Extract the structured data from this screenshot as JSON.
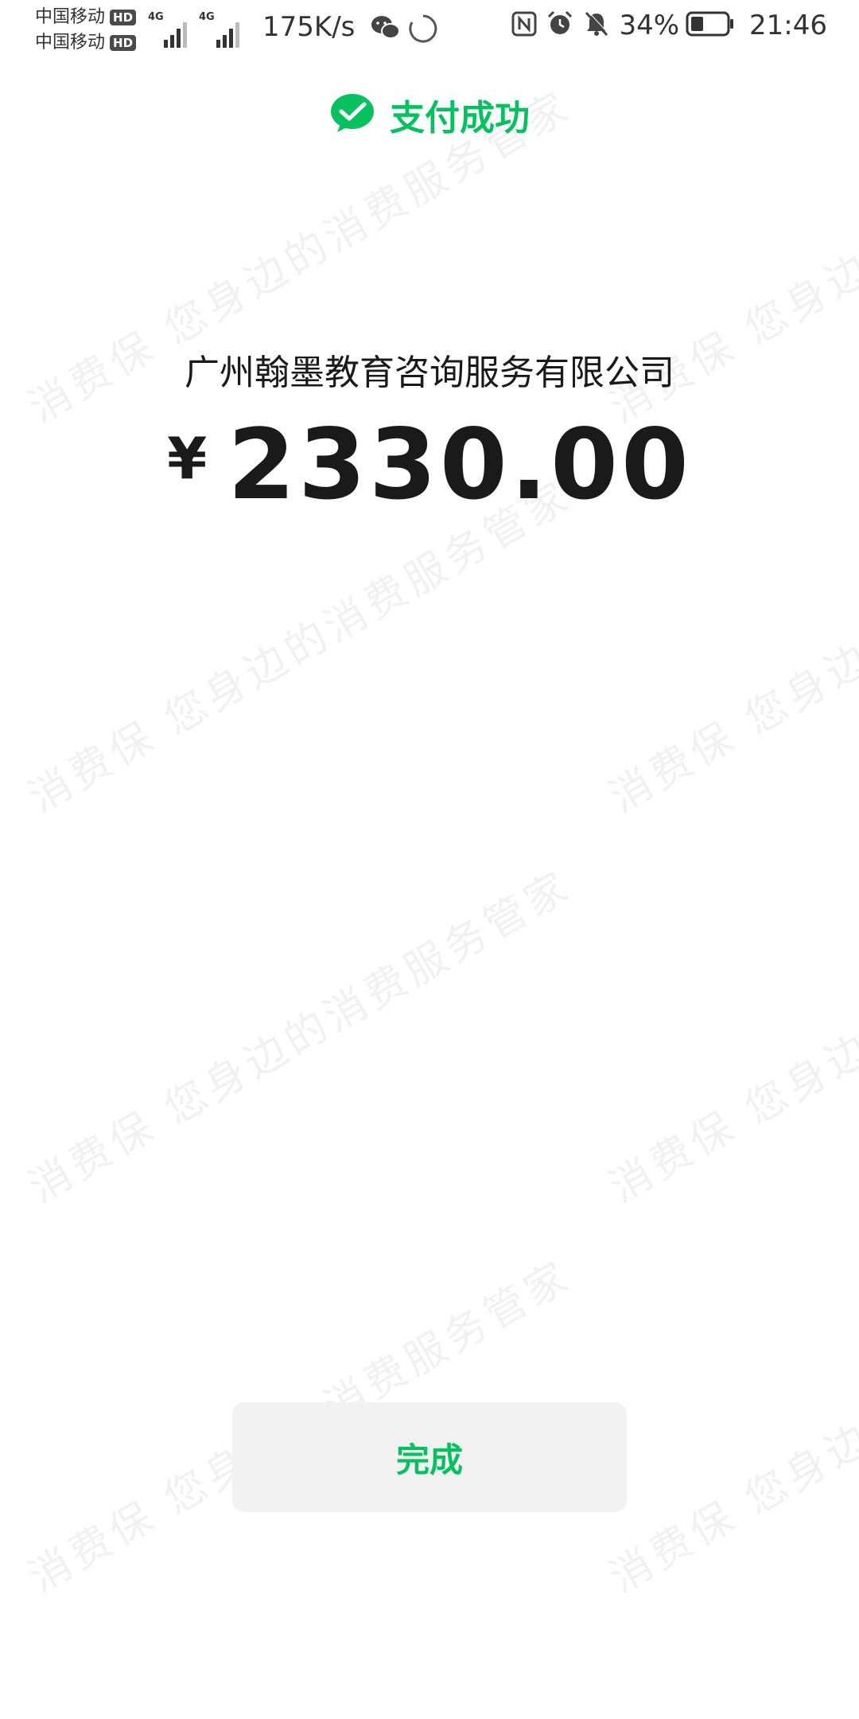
{
  "status_bar": {
    "carriers": [
      {
        "name": "中国移动",
        "badge": "HD"
      },
      {
        "name": "中国移动",
        "badge": "HD"
      }
    ],
    "signals": [
      "4G",
      "4G"
    ],
    "net_speed": "175K/s",
    "battery_percent": "34%",
    "time": "21:46"
  },
  "header": {
    "icon": "wechat-pay-check-icon",
    "title": "支付成功"
  },
  "payment": {
    "merchant": "广州翰墨教育咨询服务有限公司",
    "currency_symbol": "¥",
    "amount": "2330.00"
  },
  "actions": {
    "done_label": "完成"
  },
  "watermark": {
    "text": "消费保 您身边的消费服务管家"
  },
  "colors": {
    "brand_green": "#07c160",
    "button_bg": "#f2f2f2"
  }
}
